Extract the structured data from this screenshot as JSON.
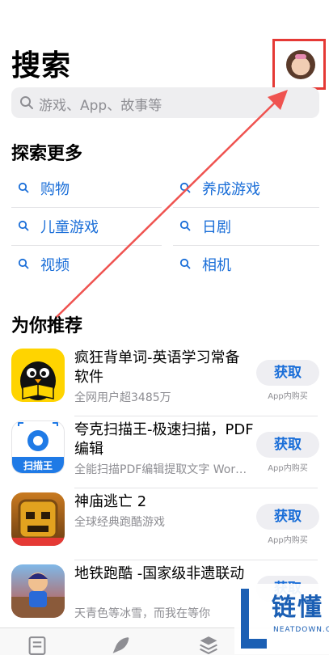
{
  "header": {
    "title": "搜索"
  },
  "search": {
    "placeholder": "游戏、App、故事等"
  },
  "explore": {
    "heading": "探索更多",
    "items": [
      "购物",
      "养成游戏",
      "儿童游戏",
      "日剧",
      "视频",
      "相机"
    ]
  },
  "recommend": {
    "heading": "为你推荐",
    "apps": [
      {
        "name": "疯狂背单词-英语学习常备软件",
        "subtitle": "全网用户超3485万",
        "button": "获取",
        "note": "App内购买"
      },
      {
        "name": "夸克扫描王-极速扫描，PDF编辑",
        "subtitle": "全能扫描PDF编辑提取文字 Wor…",
        "button": "获取",
        "note": "App内购买",
        "icon_text": "扫描王"
      },
      {
        "name": "神庙逃亡 2",
        "subtitle": "全球经典跑酷游戏",
        "button": "获取",
        "note": "App内购买"
      },
      {
        "name": "地铁跑酷 -国家级非遗联动",
        "subtitle": "天青色等冰雪，而我在等你",
        "button": "获取",
        "note": ""
      }
    ]
  },
  "tabbar": {
    "icons": [
      "today-icon",
      "games-icon",
      "apps-icon"
    ]
  },
  "watermark": {
    "brand": "链懂",
    "site": "NEATDOWN.COM"
  },
  "colors": {
    "accent": "#1a6ed8",
    "annotation": "#e53935"
  }
}
